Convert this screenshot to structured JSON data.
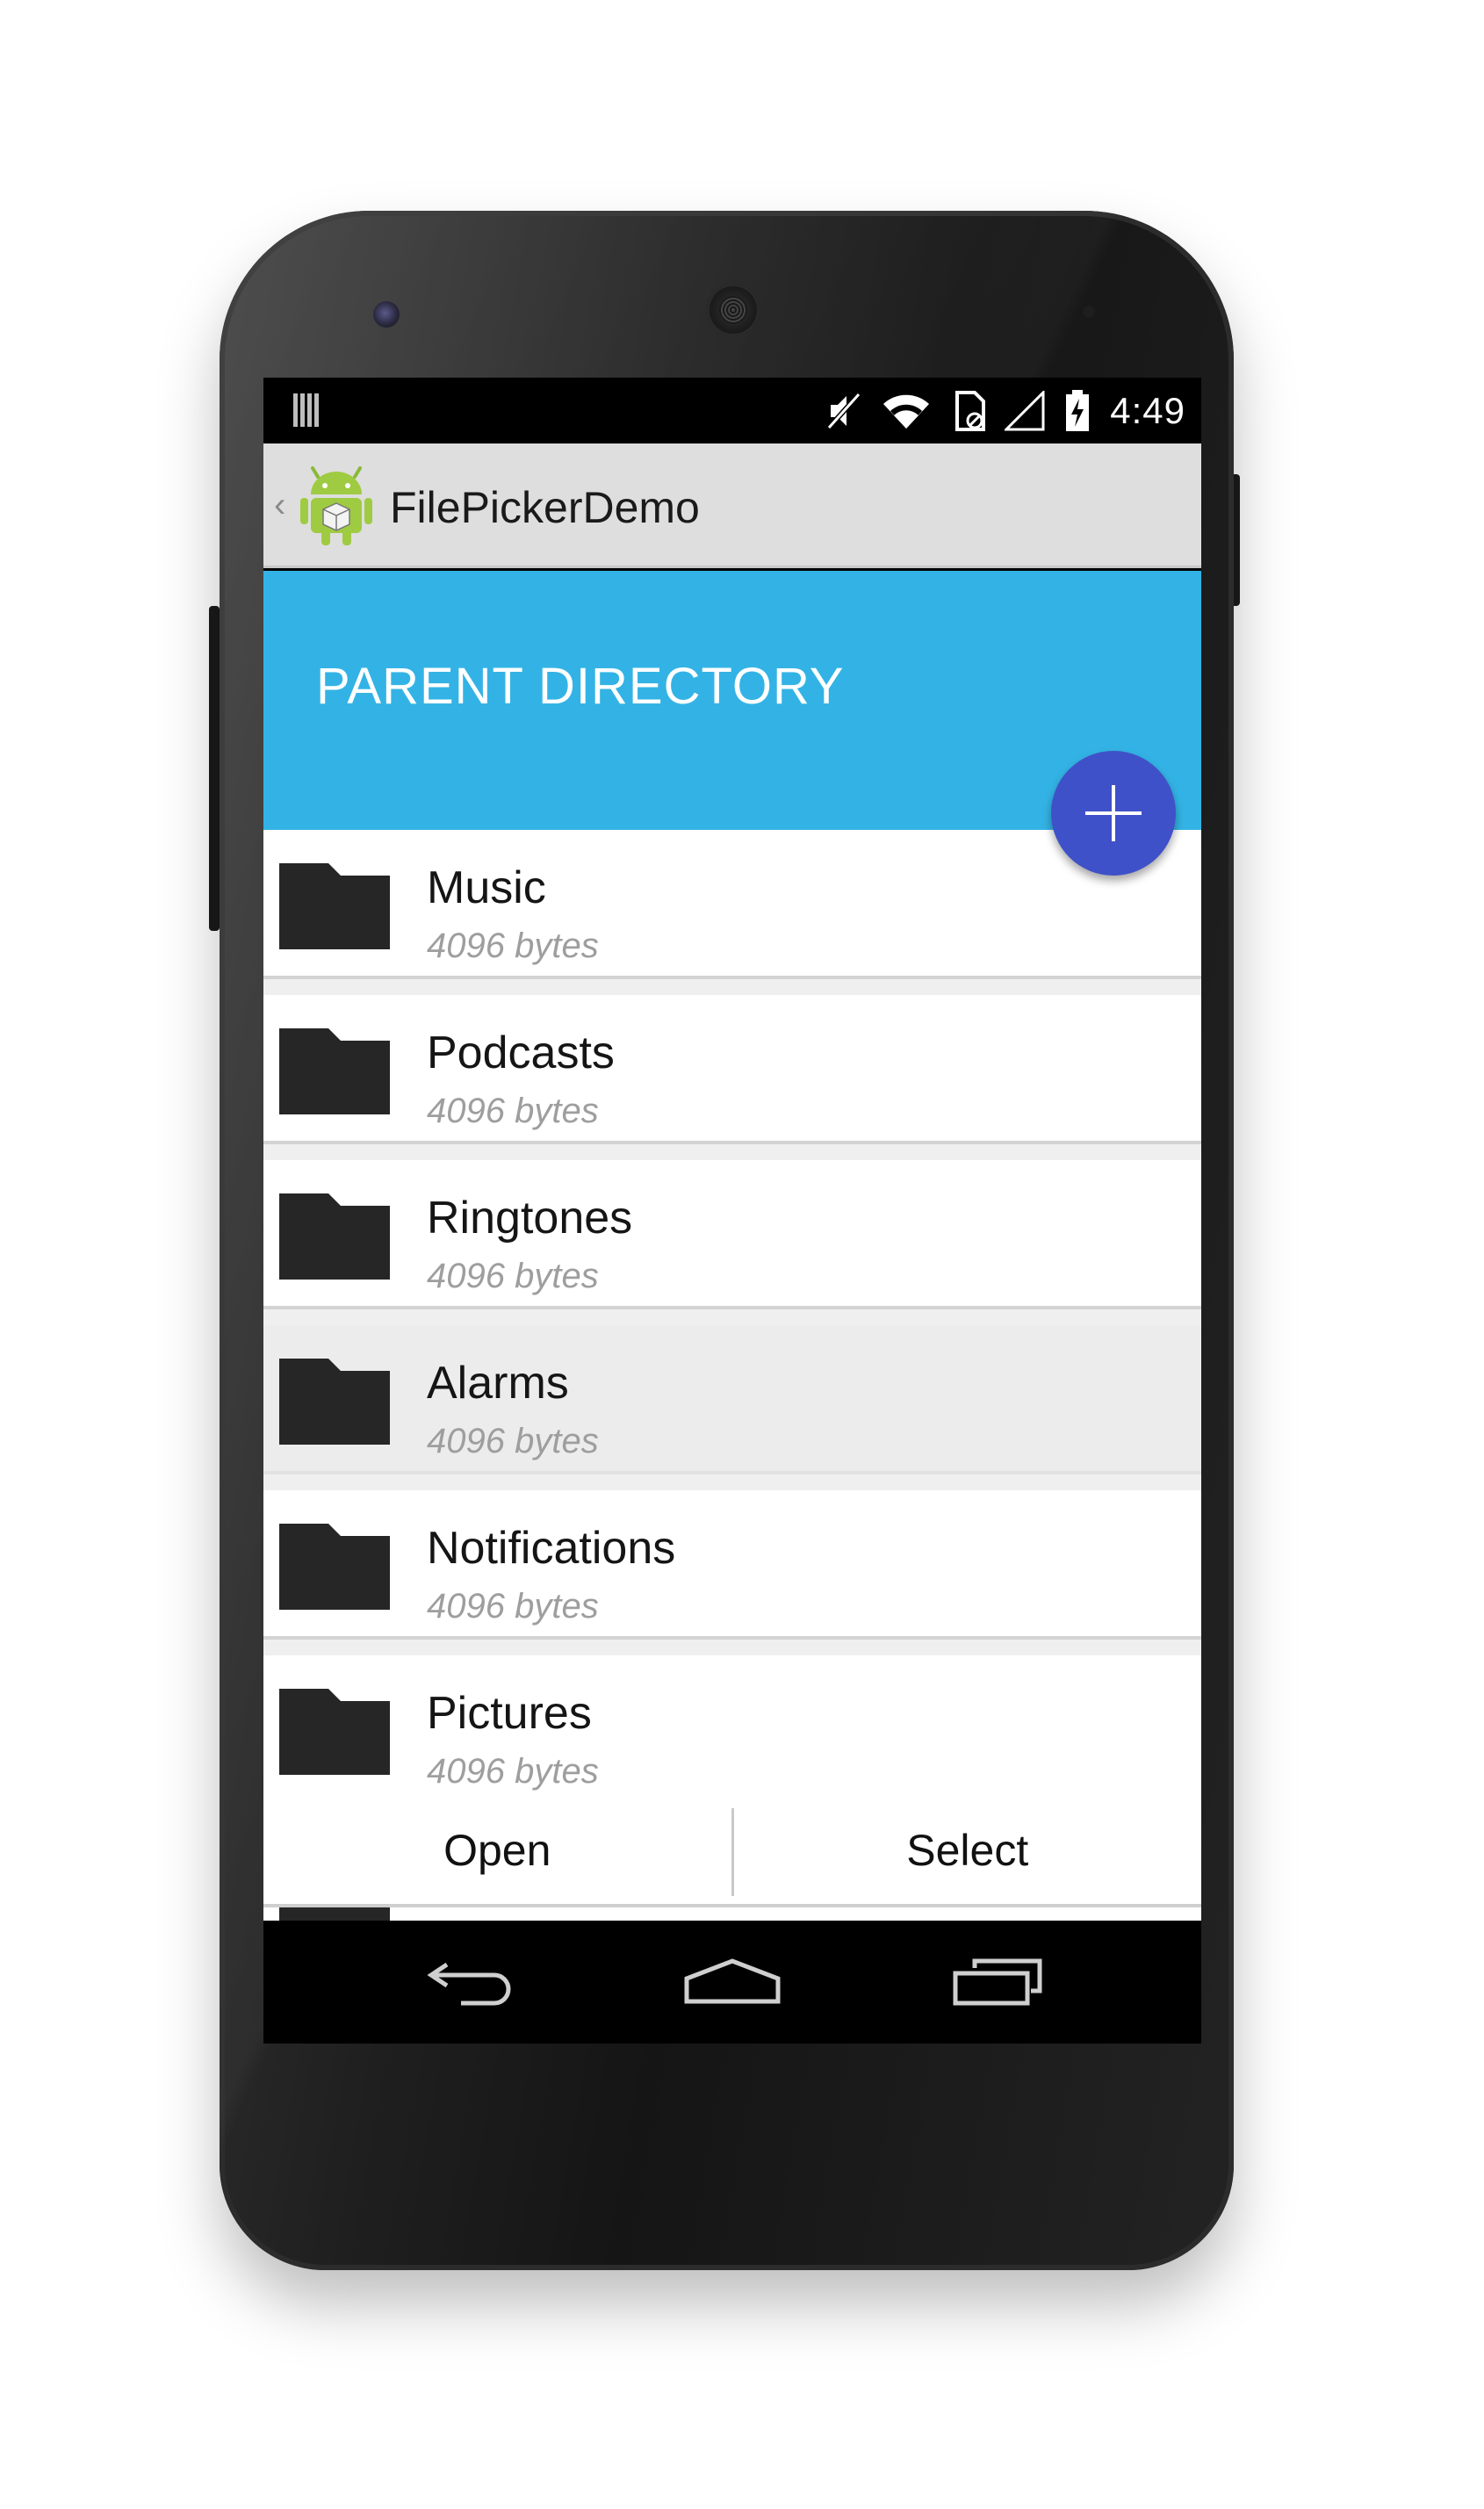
{
  "status_bar": {
    "time": "4:49",
    "icons": [
      "notification-icon",
      "mute-icon",
      "wifi-icon",
      "sd-card-icon",
      "signal-icon",
      "battery-charging-icon"
    ]
  },
  "action_bar": {
    "title": "FilePickerDemo",
    "icon": "android-app-icon"
  },
  "header": {
    "title": "PARENT DIRECTORY"
  },
  "fab": {
    "icon": "add-icon"
  },
  "files": [
    {
      "name": "Music",
      "size": "4096 bytes",
      "selected": false
    },
    {
      "name": "Podcasts",
      "size": "4096 bytes",
      "selected": false
    },
    {
      "name": "Ringtones",
      "size": "4096 bytes",
      "selected": false
    },
    {
      "name": "Alarms",
      "size": "4096 bytes",
      "selected": true
    },
    {
      "name": "Notifications",
      "size": "4096 bytes",
      "selected": false
    },
    {
      "name": "Pictures",
      "size": "4096 bytes",
      "selected": false
    }
  ],
  "buttons": {
    "open": "Open",
    "select": "Select"
  },
  "nav": [
    "back-icon",
    "home-icon",
    "recents-icon"
  ],
  "colors": {
    "accent": "#33b3e5",
    "fab": "#3f51c8"
  }
}
